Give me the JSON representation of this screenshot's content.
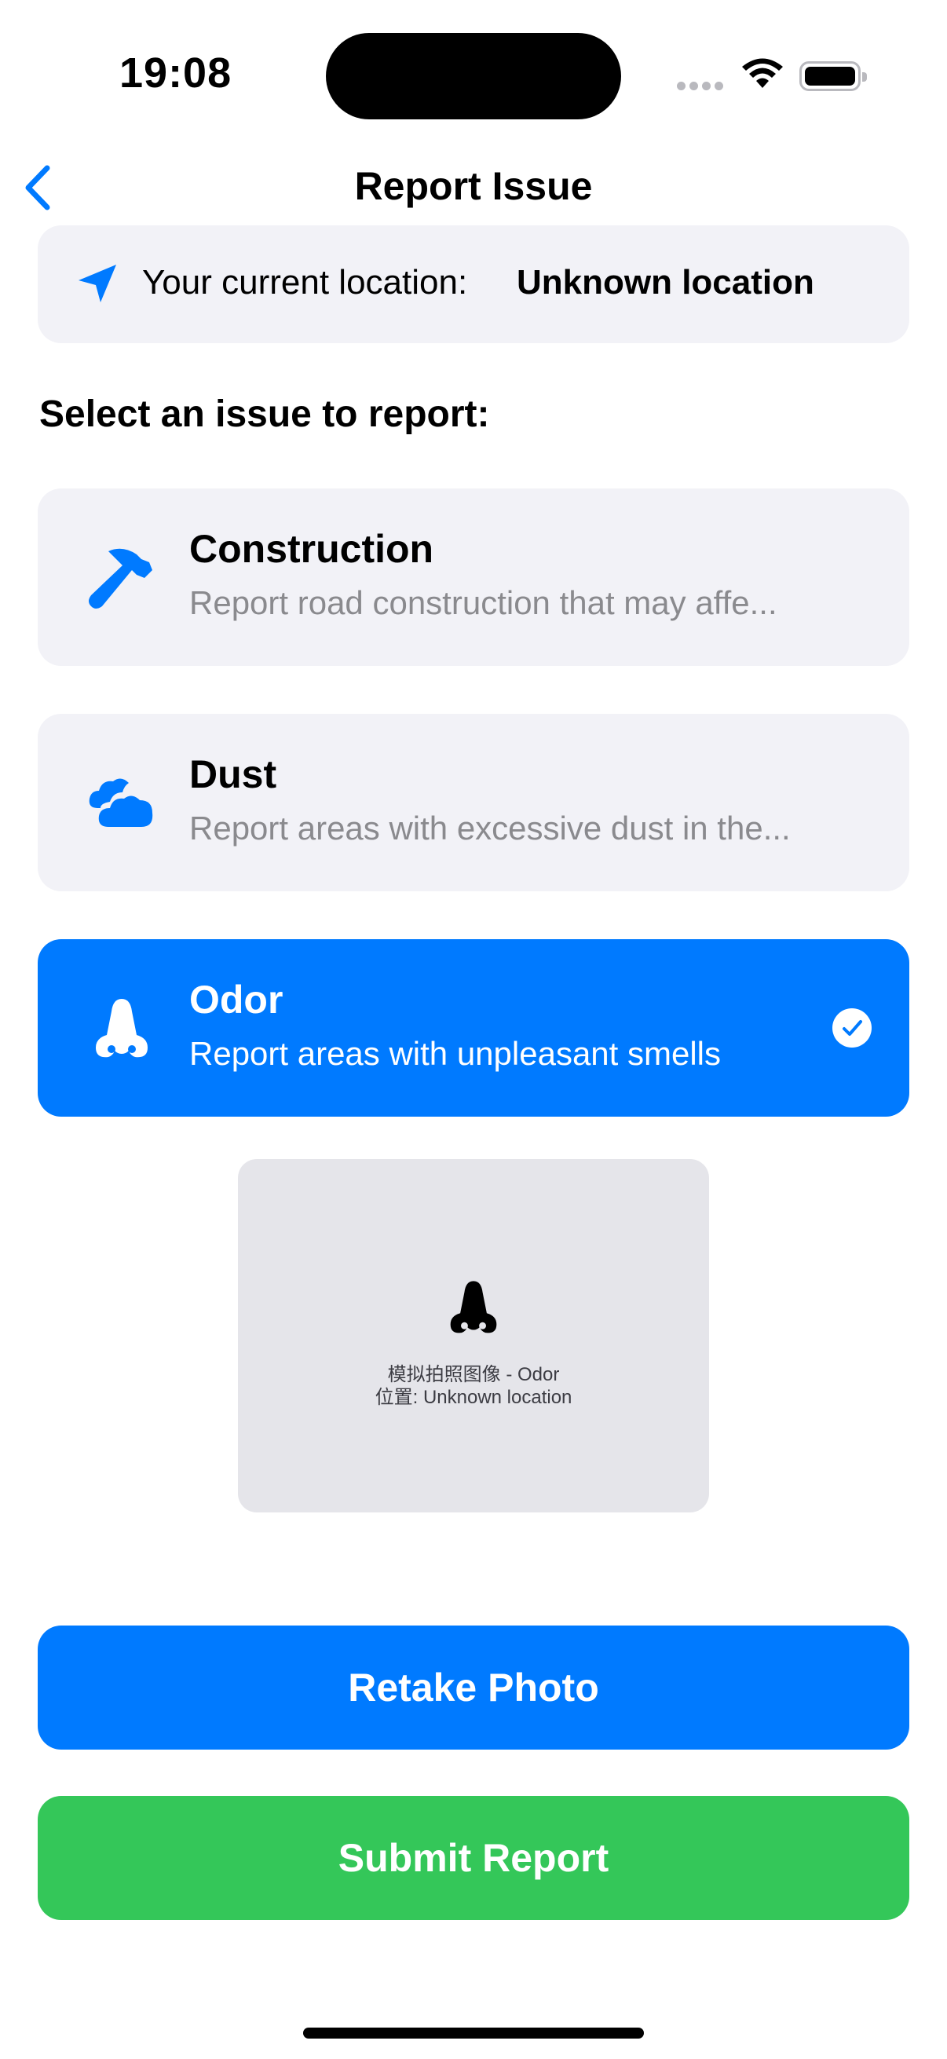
{
  "status_bar": {
    "time": "19:08",
    "icons": [
      "signal-dots-icon",
      "wifi-icon",
      "battery-icon"
    ]
  },
  "nav": {
    "title": "Report Issue",
    "back_icon": "chevron-left-icon"
  },
  "location": {
    "icon": "location-arrow-icon",
    "label": "Your current location:",
    "value": "Unknown location"
  },
  "section_title": "Select an issue to report:",
  "issues": [
    {
      "title": "Construction",
      "description": "Report road construction that may affe...",
      "icon": "hammer-icon",
      "selected": false
    },
    {
      "title": "Dust",
      "description": "Report areas with excessive dust in the...",
      "icon": "cloud-icon",
      "selected": false
    },
    {
      "title": "Odor",
      "description": "Report areas with unpleasant smells",
      "icon": "nose-icon",
      "selected": true
    }
  ],
  "photo": {
    "icon": "nose-icon",
    "caption_line1": "模拟拍照图像 - Odor",
    "caption_line2": "位置: Unknown location"
  },
  "buttons": {
    "retake": "Retake Photo",
    "submit": "Submit Report"
  },
  "colors": {
    "accent": "#007aff",
    "success": "#34c759",
    "card_bg": "#f2f2f7",
    "photo_bg": "#e5e5ea",
    "secondary_text": "#8a8a8e"
  }
}
